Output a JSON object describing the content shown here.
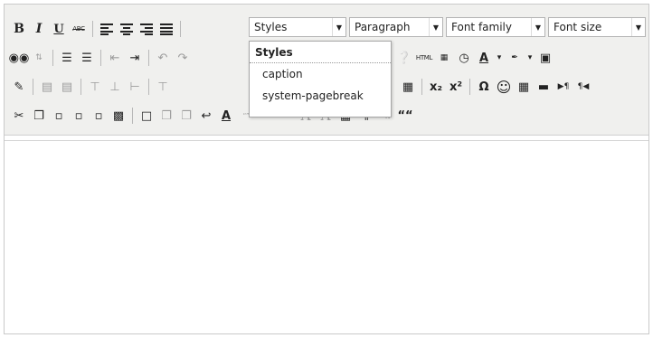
{
  "toolbar": {
    "bold": "B",
    "italic": "I",
    "underline": "U",
    "strike": "ABC",
    "sub": "x₂",
    "sup": "x²",
    "omega": "Ω",
    "smile": "☺",
    "pilcrow": "¶",
    "quote": "““",
    "html": "HTML",
    "abbr": "ABBR",
    "abc": "A.B.C.",
    "quote_marks": "“”"
  },
  "combos": {
    "styles": "Styles",
    "paragraph": "Paragraph",
    "font_family": "Font family",
    "font_size": "Font size"
  },
  "styles_menu": {
    "header": "Styles",
    "items": [
      "caption",
      "system-pagebreak"
    ]
  },
  "colors": {
    "toolbar_bg": "#f0f0ee",
    "border": "#c9c9c9"
  }
}
